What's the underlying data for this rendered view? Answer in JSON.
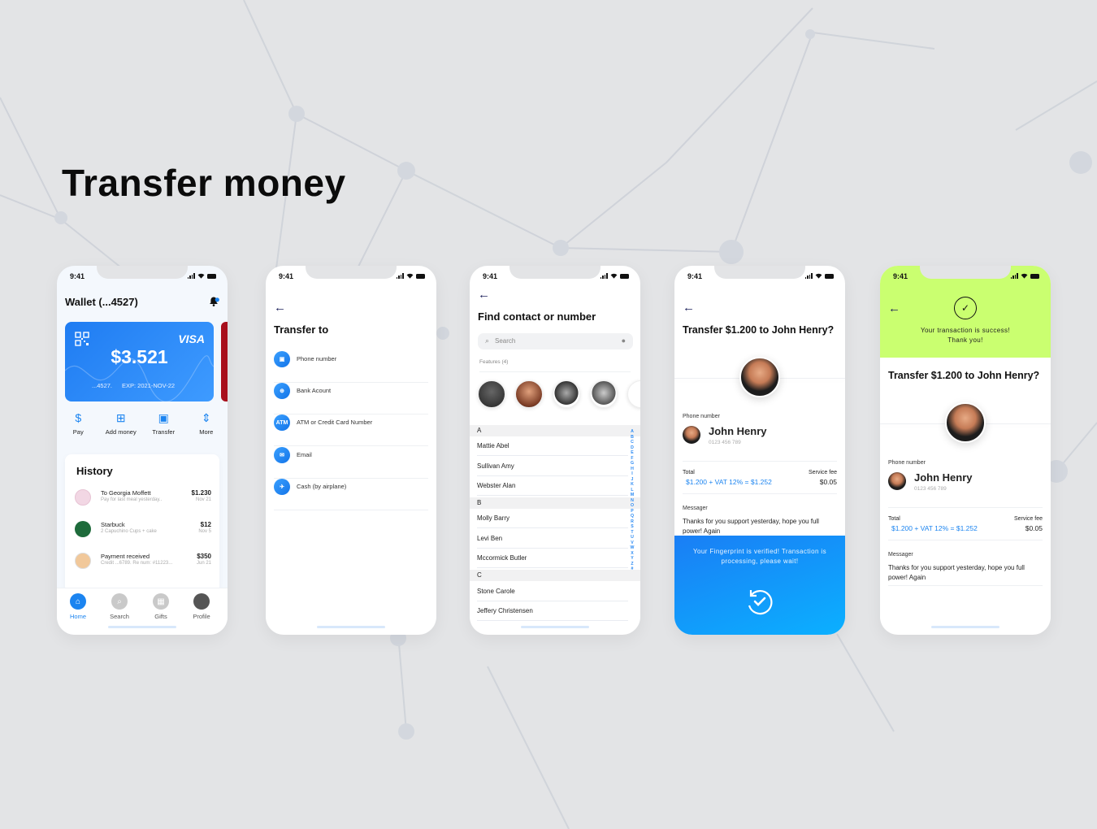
{
  "headline": "Transfer money",
  "status": {
    "time": "9:41"
  },
  "wallet": {
    "title": "Wallet (...4527)",
    "card": {
      "brand": "VISA",
      "balance": "$3.521",
      "number": "...4527.",
      "expiry": "EXP: 2021-NOV-22"
    },
    "actions": [
      {
        "label": "Pay",
        "icon": "pay-icon"
      },
      {
        "label": "Add money",
        "icon": "add-money-icon"
      },
      {
        "label": "Transfer",
        "icon": "transfer-icon"
      },
      {
        "label": "More",
        "icon": "more-icon"
      }
    ],
    "history": {
      "title": "History",
      "items": [
        {
          "title": "To Georgia Moffett",
          "subtitle": "Pay for last meal yesterday..",
          "amount": "$1.230",
          "date": "Nov 21",
          "color": "#f2d7e4"
        },
        {
          "title": "Starbuck",
          "subtitle": "2 Capuchino Cups + cake",
          "amount": "$12",
          "date": "Nov 5",
          "color": "#1e6b3b"
        },
        {
          "title": "Payment received",
          "subtitle": "Credit ...6789. Re num: #11223...",
          "amount": "$350",
          "date": "Jun 21",
          "color": "#f1c89a"
        }
      ]
    },
    "tabs": [
      {
        "label": "Home",
        "active": true
      },
      {
        "label": "Search"
      },
      {
        "label": "Gifts"
      },
      {
        "label": "Profile"
      }
    ]
  },
  "transfer_to": {
    "back": "←",
    "title": "Transfer to",
    "options": [
      {
        "label": "Phone number",
        "icon_text": "▣"
      },
      {
        "label": "Bank Acount",
        "icon_text": "⊕"
      },
      {
        "label": "ATM or Credit Card Number",
        "icon_text": "ATM"
      },
      {
        "label": "Email",
        "icon_text": "✉"
      },
      {
        "label": "Cash (by airplane)",
        "icon_text": "✈"
      }
    ]
  },
  "find_contact": {
    "back": "←",
    "title": "Find contact or number",
    "search_placeholder": "Search",
    "features_label": "Features (4)",
    "sections": [
      {
        "letter": "A",
        "contacts": [
          "Mattie Abel",
          "Sullivan Amy",
          "Webster Alan"
        ]
      },
      {
        "letter": "B",
        "contacts": [
          "Molly Barry",
          "Levi Ben",
          "Mccormick Butler"
        ]
      },
      {
        "letter": "C",
        "contacts": [
          "Stone Carole",
          "Jeffery Christensen"
        ]
      }
    ],
    "alphabet": [
      "A",
      "B",
      "C",
      "D",
      "E",
      "F",
      "G",
      "H",
      "I",
      "J",
      "K",
      "L",
      "M",
      "N",
      "O",
      "P",
      "Q",
      "R",
      "S",
      "T",
      "U",
      "V",
      "W",
      "X",
      "Y",
      "Z",
      "#"
    ]
  },
  "confirm": {
    "back": "←",
    "title": "Transfer $1.200 to John Henry?",
    "phone_label": "Phone number",
    "name": "John Henry",
    "phone": "0123 456 789",
    "total_label": "Total",
    "total_value": "$1.200 + VAT 12% = $1.252",
    "fee_label": "Service fee",
    "fee_value": "$0.05",
    "message_label": "Messager",
    "message": "Thanks for you support yesterday, hope you full power! Again",
    "verify_text": "Your Fingerprint is verified! Transaction is processing, please wait!"
  },
  "success": {
    "back": "←",
    "text_line1": "Your transaction is success!",
    "text_line2": "Thank you!",
    "title": "Transfer $1.200 to John Henry?",
    "phone_label": "Phone number",
    "name": "John Henry",
    "phone": "0123 456 789",
    "total_label": "Total",
    "total_value": "$1.200 + VAT 12% = $1.252",
    "fee_label": "Service fee",
    "fee_value": "$0.05",
    "message_label": "Messager",
    "message": "Thanks for you support yesterday, hope you full power! Again"
  },
  "colors": {
    "accent": "#1b84f0",
    "success_bg": "#caff70",
    "background": "#e3e4e6"
  }
}
